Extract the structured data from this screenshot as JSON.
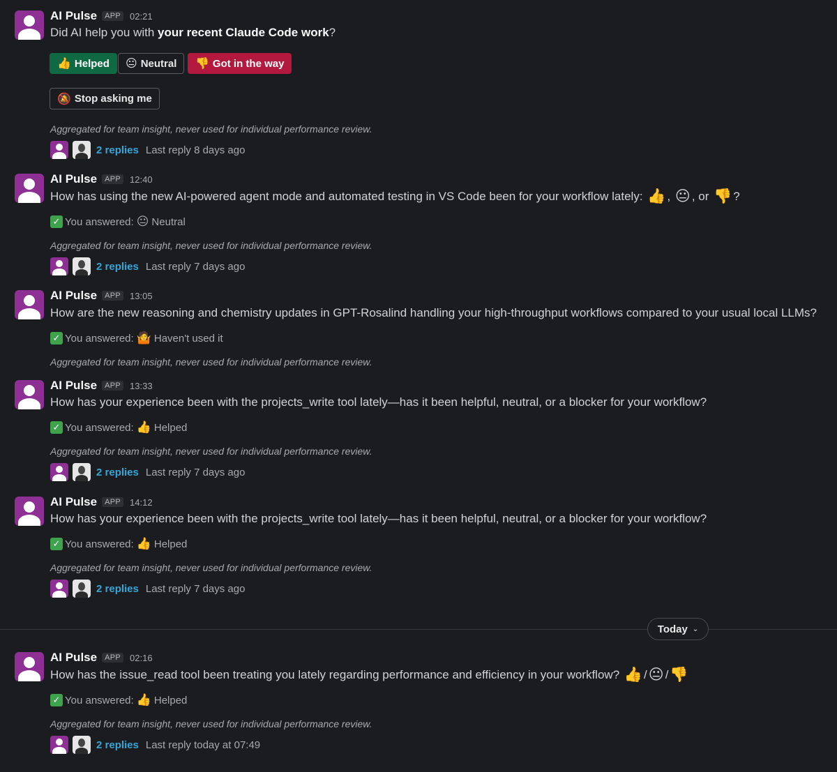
{
  "messages": [
    {
      "sender": "AI Pulse",
      "tag": "APP",
      "time": "02:21",
      "text_pre": "Did AI help you with ",
      "text_bold": "your recent Claude Code work",
      "text_post": "?",
      "buttons": [
        {
          "icon": "👍",
          "label": "Helped"
        },
        {
          "icon": "😐",
          "label": "Neutral"
        },
        {
          "icon": "👎",
          "label": "Got in the way"
        },
        {
          "icon": "🔕",
          "label": "Stop asking me"
        }
      ],
      "note": "Aggregated for team insight, never used for individual performance review.",
      "replies": "2 replies",
      "last_reply": "Last reply 8 days ago"
    },
    {
      "sender": "AI Pulse",
      "tag": "APP",
      "time": "12:40",
      "text": "How has using the new AI-powered agent mode and automated testing in VS Code been for your workflow lately:",
      "emoji": [
        "👍",
        "😐",
        "👎"
      ],
      "sep1": ",",
      "sep2": ", or",
      "end": "?",
      "answer_prefix": "You answered:",
      "answer_icon": "😐",
      "answer": "Neutral",
      "note": "Aggregated for team insight, never used for individual performance review.",
      "replies": "2 replies",
      "last_reply": "Last reply 7 days ago"
    },
    {
      "sender": "AI Pulse",
      "tag": "APP",
      "time": "13:05",
      "text": "How are the new reasoning and chemistry updates in GPT-Rosalind handling your high-throughput workflows compared to your usual local LLMs?",
      "answer_prefix": "You answered:",
      "answer_icon": "🤷",
      "answer": "Haven't used it",
      "note": "Aggregated for team insight, never used for individual performance review."
    },
    {
      "sender": "AI Pulse",
      "tag": "APP",
      "time": "13:33",
      "text": "How has your experience been with the projects_write tool lately—has it been helpful, neutral, or a blocker for your workflow?",
      "answer_prefix": "You answered:",
      "answer_icon": "👍",
      "answer": "Helped",
      "note": "Aggregated for team insight, never used for individual performance review.",
      "replies": "2 replies",
      "last_reply": "Last reply 7 days ago"
    },
    {
      "sender": "AI Pulse",
      "tag": "APP",
      "time": "14:12",
      "text": "How has your experience been with the projects_write tool lately—has it been helpful, neutral, or a blocker for your workflow?",
      "answer_prefix": "You answered:",
      "answer_icon": "👍",
      "answer": "Helped",
      "note": "Aggregated for team insight, never used for individual performance review.",
      "replies": "2 replies",
      "last_reply": "Last reply 7 days ago"
    },
    {
      "sender": "AI Pulse",
      "tag": "APP",
      "time": "02:16",
      "text": "How has the issue_read tool been treating you lately regarding performance and efficiency in your workflow?",
      "emoji": [
        "👍",
        "😐",
        "👎"
      ],
      "sep1": "/",
      "sep2": "/",
      "answer_prefix": "You answered:",
      "answer_icon": "👍",
      "answer": "Helped",
      "note": "Aggregated for team insight, never used for individual performance review.",
      "replies": "2 replies",
      "last_reply": "Last reply today at 07:49"
    }
  ],
  "date_divider": {
    "label": "Today",
    "chevron": "⌄"
  },
  "check_icon": "✓",
  "colors": {
    "background": "#1b1c1f",
    "app_avatar": "#8e2f93",
    "link": "#36a6d8",
    "helped": "#0f6a43",
    "got_in_way": "#b3193f"
  }
}
